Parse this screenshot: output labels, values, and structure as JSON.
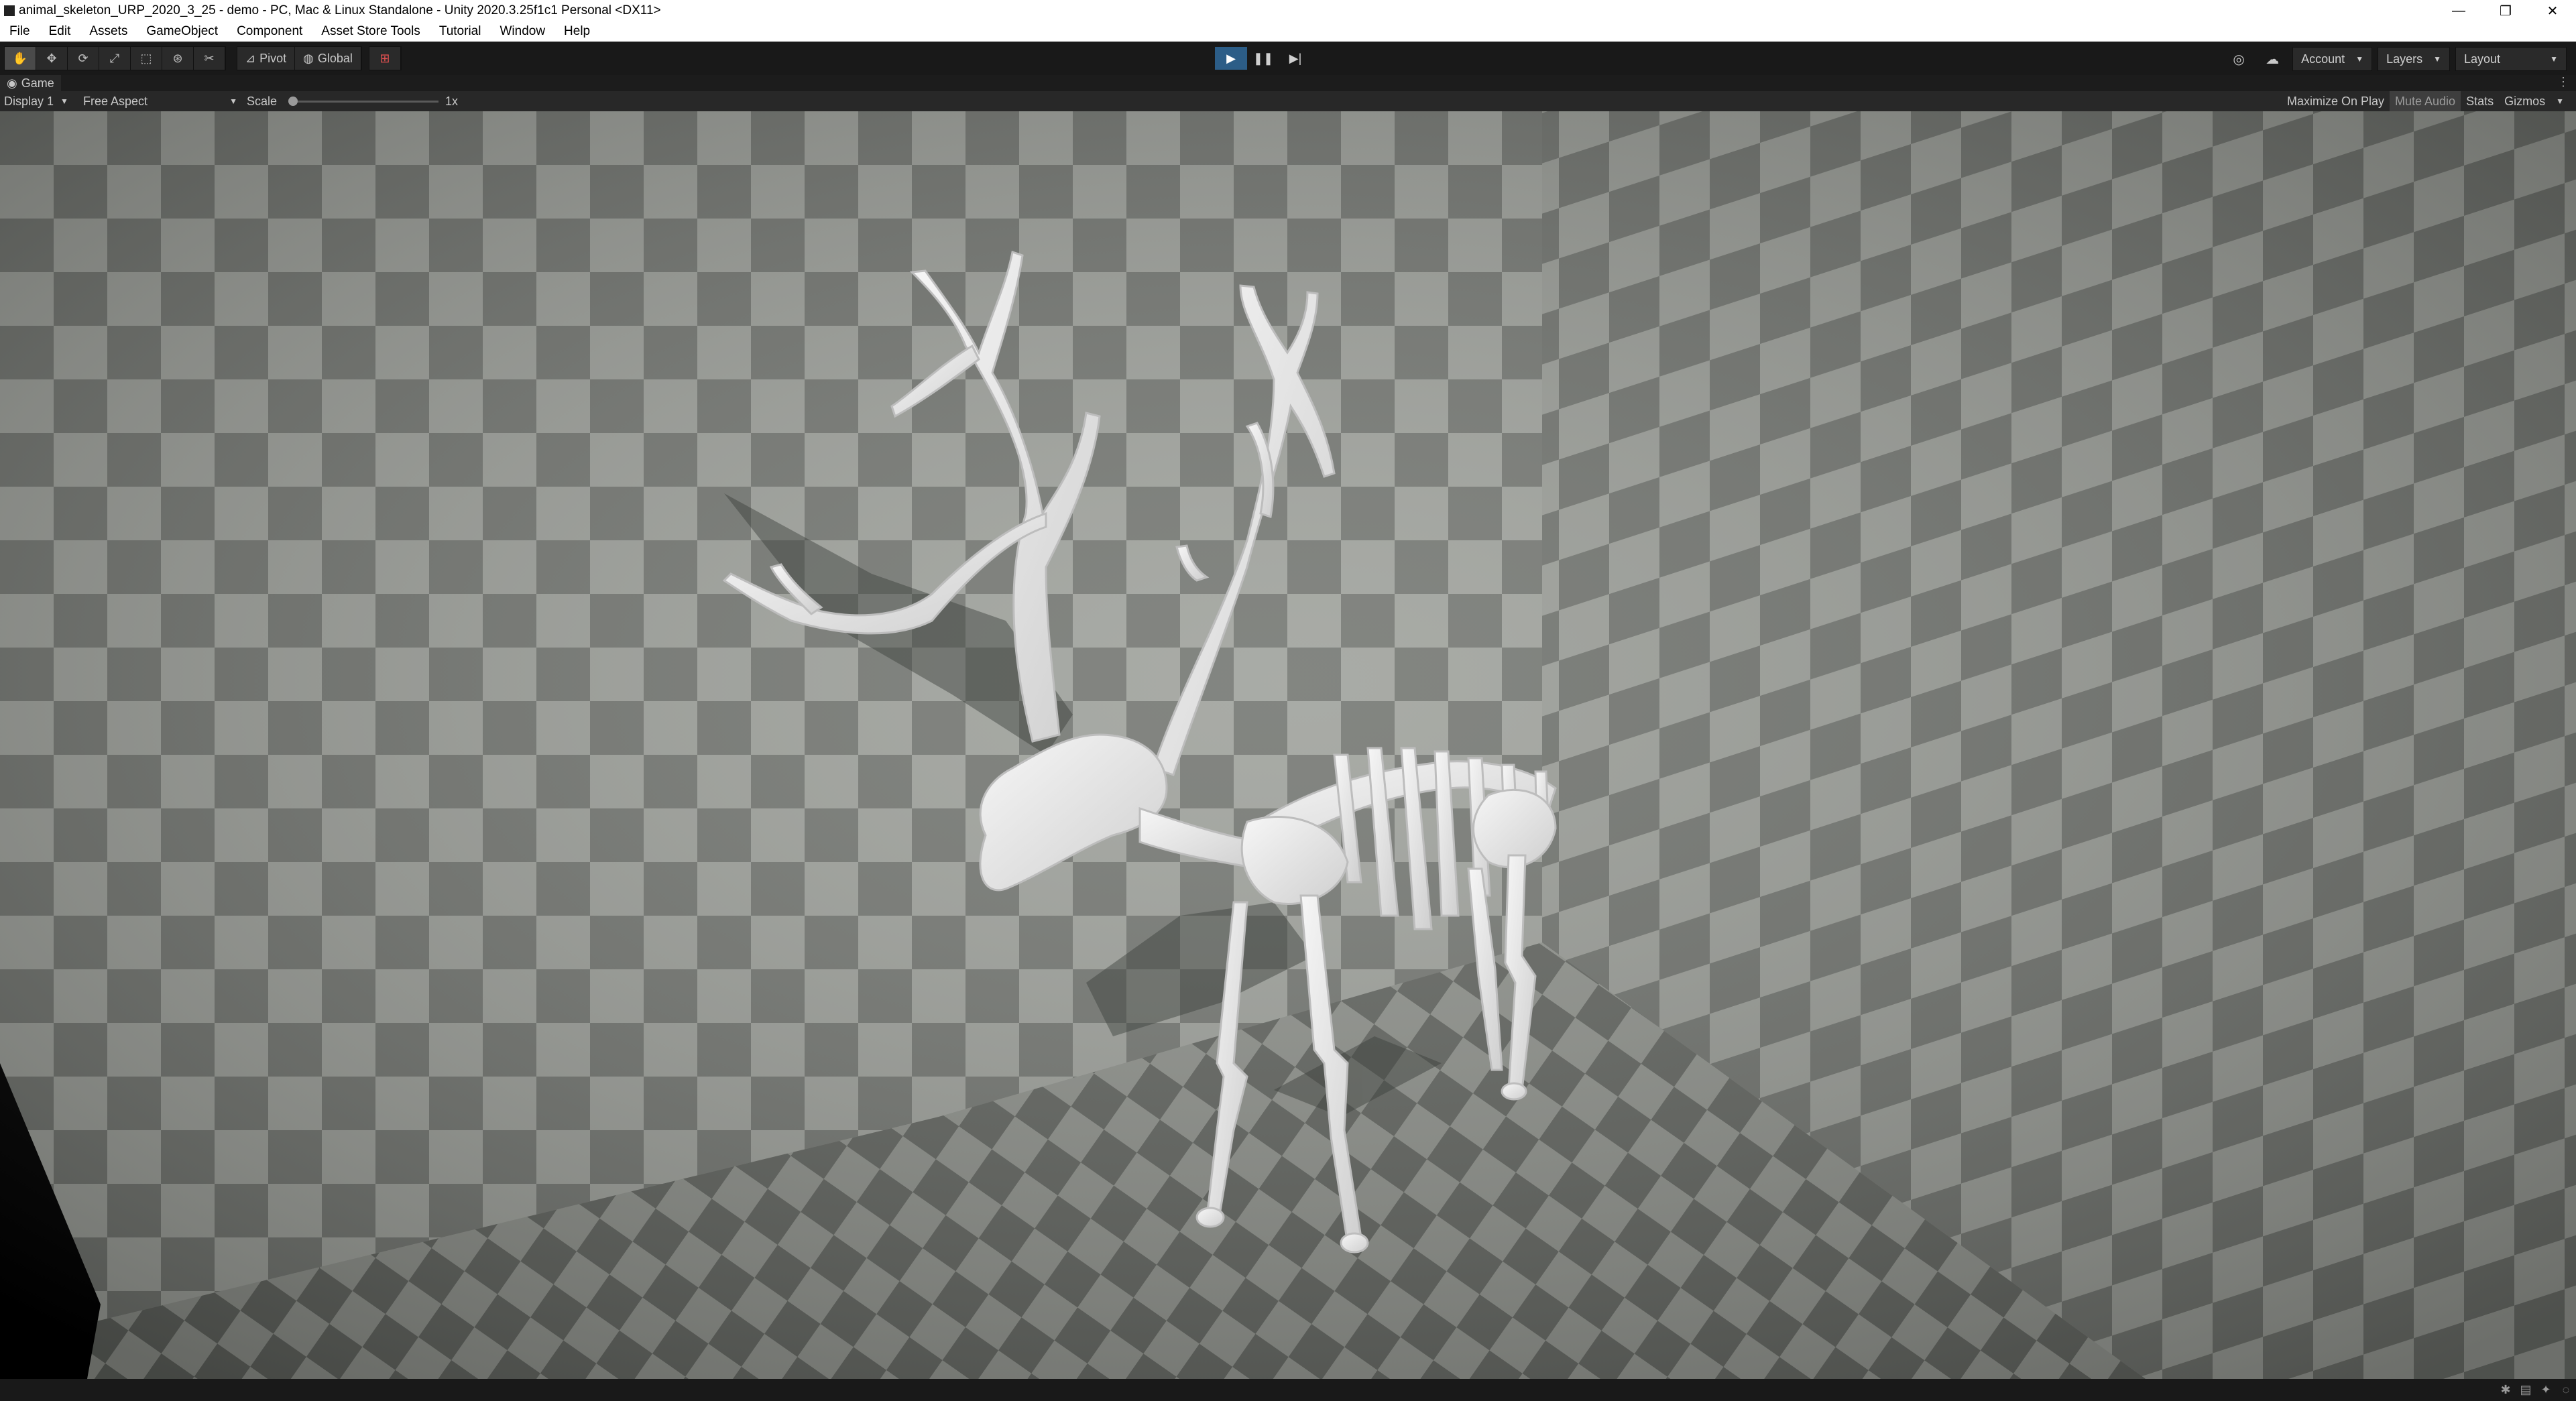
{
  "window": {
    "title": "animal_skeleton_URP_2020_3_25 - demo - PC, Mac & Linux Standalone - Unity 2020.3.25f1c1 Personal <DX11>",
    "controls": [
      "—",
      "❐",
      "✕"
    ]
  },
  "menu": [
    "File",
    "Edit",
    "Assets",
    "GameObject",
    "Component",
    "Asset Store Tools",
    "Tutorial",
    "Window",
    "Help"
  ],
  "toolbar": {
    "tools": [
      "hand-icon",
      "move-icon",
      "rotate-icon",
      "scale-icon",
      "rect-icon",
      "transform-icon",
      "custom-tool-icon"
    ],
    "pivot_label": "Pivot",
    "global_label": "Global",
    "account_label": "Account",
    "layers_label": "Layers",
    "layout_label": "Layout"
  },
  "game_tab": {
    "label": "Game"
  },
  "game_toolbar": {
    "display": "Display 1",
    "aspect": "Free Aspect",
    "scale_label": "Scale",
    "scale_value": "1x",
    "maximize": "Maximize On Play",
    "mute": "Mute Audio",
    "stats": "Stats",
    "gizmos": "Gizmos"
  },
  "colors": {
    "accent_play": "#2c5d87",
    "checker_light": "#9da09a",
    "checker_dark": "#727570",
    "bone": "#eeeeee"
  }
}
